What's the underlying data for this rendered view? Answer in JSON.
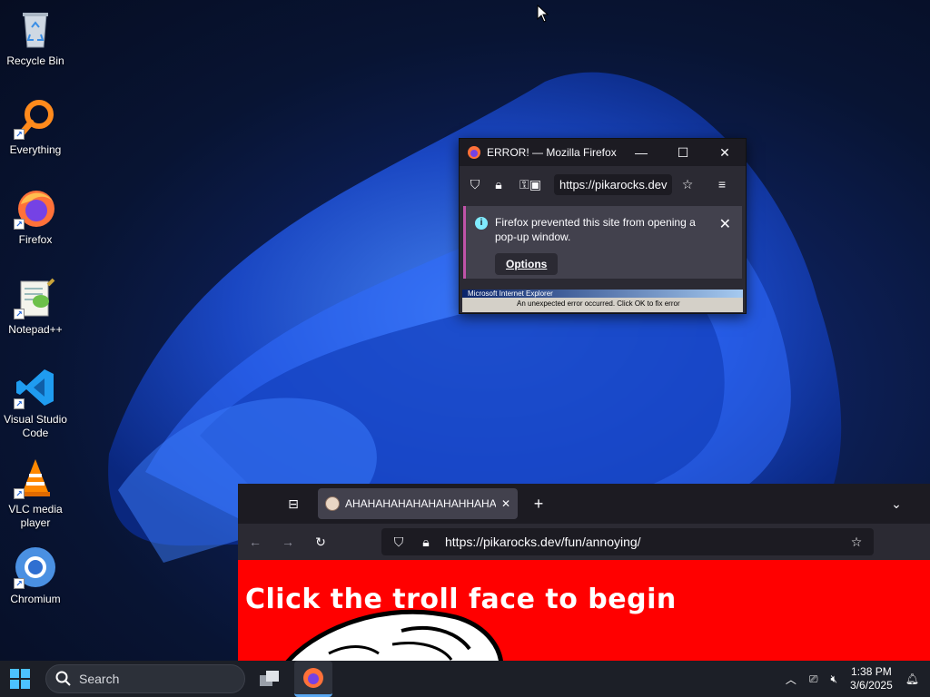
{
  "desktop": {
    "icons": [
      {
        "label": "Recycle Bin",
        "icon": "recycle-bin-icon"
      },
      {
        "label": "Everything",
        "icon": "everything-search-icon"
      },
      {
        "label": "Firefox",
        "icon": "firefox-icon"
      },
      {
        "label": "Notepad++",
        "icon": "notepad-plus-plus-icon"
      },
      {
        "label": "Visual Studio Code",
        "icon": "vscode-icon"
      },
      {
        "label": "VLC media player",
        "icon": "vlc-icon"
      },
      {
        "label": "Chromium",
        "icon": "chromium-icon"
      }
    ]
  },
  "popup_window": {
    "title": "ERROR! — Mozilla Firefox",
    "url": "https://pikarocks.dev",
    "notice_message": "Firefox prevented this site from opening a pop-up window.",
    "options_label": "Options",
    "ie_title": "Microsoft Internet Explorer",
    "ie_message": "An unexpected error occurred. Click OK to fix error"
  },
  "main_window": {
    "tab_title": "AHAHAHAHAHAHAHAHHAHAHAH",
    "url": "https://pikarocks.dev/fun/annoying/",
    "headline": "Click the troll face to begin",
    "background_color": "#ff0000"
  },
  "taskbar": {
    "search_placeholder": "Search",
    "time": "1:38 PM",
    "date": "3/6/2025"
  },
  "colors": {
    "firefox_dark": "#2b2a33",
    "accent": "#5aa7f0"
  }
}
